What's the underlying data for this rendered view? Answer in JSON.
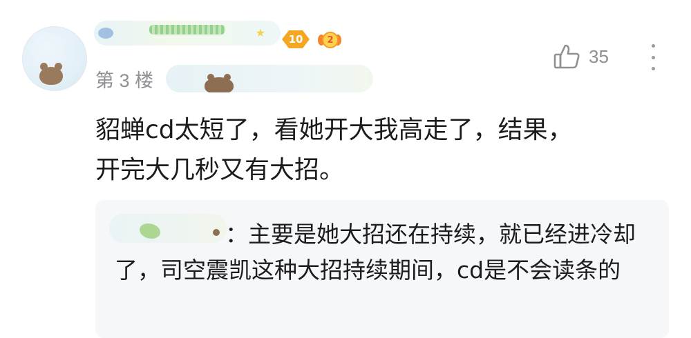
{
  "user": {
    "level": "10",
    "medal": "2"
  },
  "post": {
    "floor": "第 3 楼",
    "likes": "35",
    "text": "貂蝉cd太短了，看她开大我高走了，结果，\n开完大几秒又有大招。"
  },
  "reply": {
    "text": "：主要是她大招还在持续，就已经进冷却了，司空震凯这种大招持续期间，cd是不会读条的"
  },
  "icons": {
    "like": "thumbs-up-icon",
    "more": "more-vertical-icon"
  },
  "colors": {
    "level_badge": "#f5a623",
    "reply_background": "#f6f7f9",
    "secondary_text": "#8f8f94"
  }
}
